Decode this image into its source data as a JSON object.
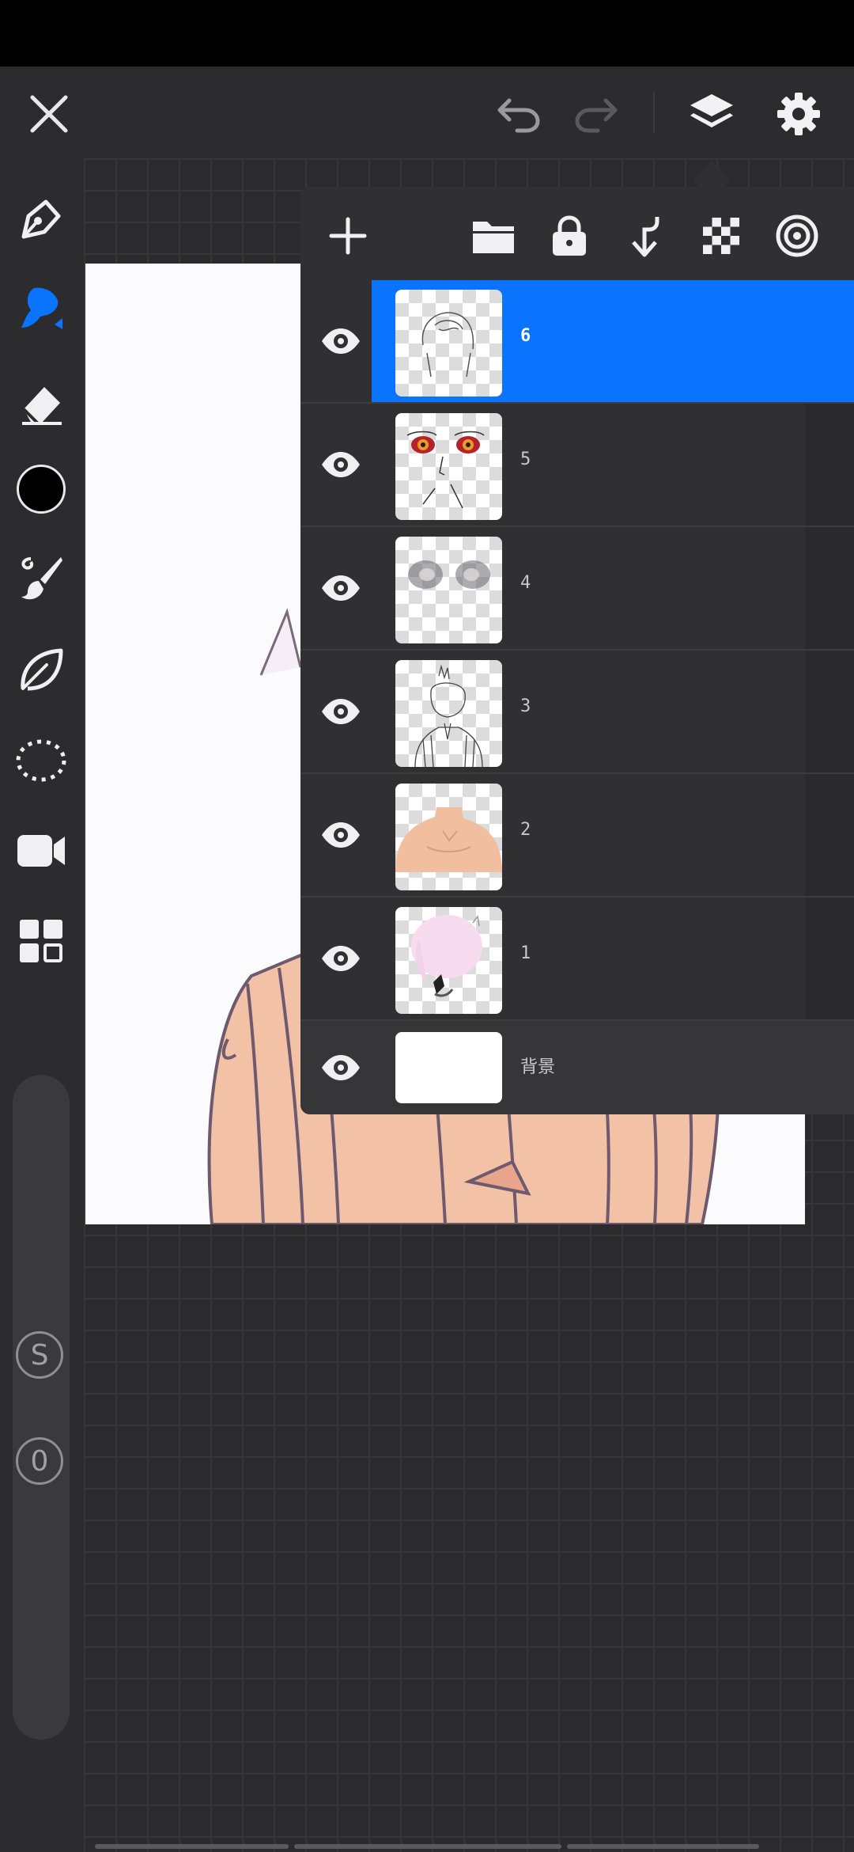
{
  "colors": {
    "accent": "#0a74ff",
    "selected_layer": "#0a74ff",
    "current_color": "#000000",
    "skin": "#f3c2a6",
    "outline": "#6e5a6e"
  },
  "toolbar": {
    "tools": [
      "pencil-icon",
      "brush-icon",
      "eraser-icon",
      "color-swatch",
      "smudge-brush-icon",
      "leaf-icon",
      "lasso-selection-icon",
      "video-icon",
      "grid-menu-icon"
    ],
    "size_label": "S",
    "opacity_label": "0"
  },
  "topbar": {
    "icons": [
      "close-icon",
      "undo-icon",
      "redo-icon",
      "layers-icon",
      "settings-icon"
    ]
  },
  "layers_panel": {
    "header_icons": [
      "add-layer-icon",
      "folder-icon",
      "lock-icon",
      "merge-down-icon",
      "transparency-icon",
      "blend-icon"
    ],
    "layers": [
      {
        "name": "6",
        "selected": true,
        "visible": true
      },
      {
        "name": "5",
        "selected": false,
        "visible": true
      },
      {
        "name": "4",
        "selected": false,
        "visible": true
      },
      {
        "name": "3",
        "selected": false,
        "visible": true
      },
      {
        "name": "2",
        "selected": false,
        "visible": true
      },
      {
        "name": "1",
        "selected": false,
        "visible": true
      }
    ],
    "background_layer": {
      "name": "背景",
      "visible": true
    }
  }
}
